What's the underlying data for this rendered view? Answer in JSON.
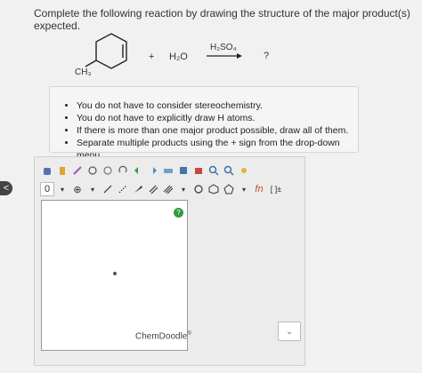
{
  "question": {
    "text": "Complete the following reaction by drawing the structure of the major product(s) expected."
  },
  "reaction": {
    "methyl_label": "CH₃",
    "plus": "+",
    "reagent": "H₂O",
    "catalyst": "H₂SO₄",
    "product": "?"
  },
  "instructions": [
    "You do not have to consider stereochemistry.",
    "You do not have to explicitly draw H atoms.",
    "If there is more than one major product possible, draw all of them.",
    "Separate multiple products using the + sign from the drop-down menu."
  ],
  "sketcher": {
    "charge_label": "0",
    "plus_symbol": "⊕",
    "help_label": "?",
    "brand": "ChemDoodle",
    "brand_mark": "®",
    "dropdown_arrow": "⌄",
    "tool_ring_label": "⬡",
    "bracket_label": "[ ]±",
    "fn_label": "fn"
  },
  "nav": {
    "back_arrow": "<"
  }
}
